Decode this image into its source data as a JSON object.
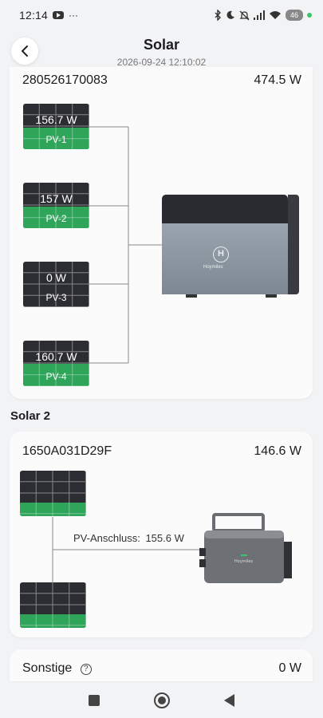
{
  "status_bar": {
    "time": "12:14",
    "more": "···",
    "battery": "46"
  },
  "header": {
    "title": "Solar",
    "timestamp": "2026-09-24 12:10:02"
  },
  "solar1": {
    "serial": "280526170083",
    "total": "474.5 W",
    "panels": [
      {
        "value": "156.7 W",
        "label": "PV-1",
        "fill_percent": 48
      },
      {
        "value": "157 W",
        "label": "PV-2",
        "fill_percent": 48
      },
      {
        "value": "0 W",
        "label": "PV-3",
        "fill_percent": 0
      },
      {
        "value": "160.7 W",
        "label": "PV-4",
        "fill_percent": 50
      }
    ],
    "device_brand": "Hoymiles"
  },
  "solar2": {
    "section_title": "Solar 2",
    "serial": "1650A031D29F",
    "total": "146.6 W",
    "connection_label": "PV-Anschluss:",
    "connection_value": "155.6 W",
    "panel_fill_percents": [
      30,
      30
    ],
    "device_brand": "Hoymiles"
  },
  "other": {
    "label": "Sonstige",
    "value": "0 W",
    "help_glyph": "?"
  },
  "colors": {
    "panel_green": "#2fa55a",
    "panel_dark": "#2c2d33",
    "accent_green": "#3ac46b"
  }
}
